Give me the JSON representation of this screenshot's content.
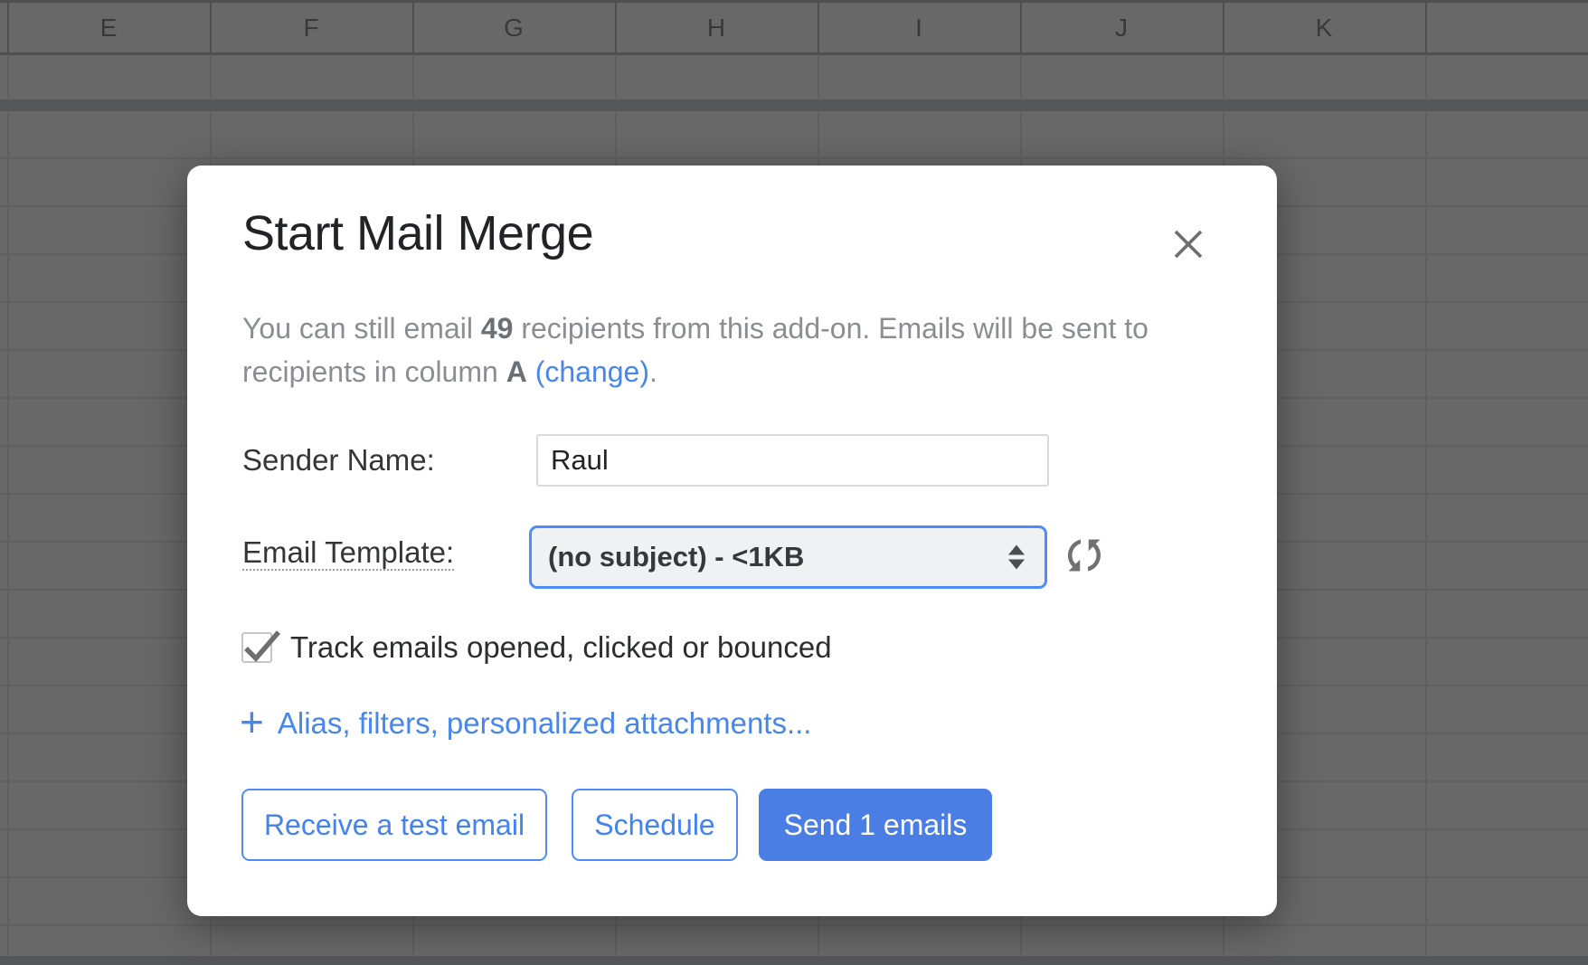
{
  "spreadsheet": {
    "columns": [
      "E",
      "F",
      "G",
      "H",
      "I",
      "J",
      "K"
    ]
  },
  "dialog": {
    "title": "Start Mail Merge",
    "intro": {
      "text_before_count": "You can still email ",
      "count": "49",
      "text_after_count": " recipients from this add-on. Emails will be sent to recipients in column ",
      "column": "A",
      "change_link": "(change)",
      "period": "."
    },
    "sender_name": {
      "label": "Sender Name:",
      "value": "Raul"
    },
    "email_template": {
      "label": "Email Template:",
      "selected_option": "(no subject) - <1KB"
    },
    "tracking": {
      "label": "Track emails opened, clicked or bounced",
      "checked": true
    },
    "alias_link": {
      "plus": "+",
      "label": "Alias, filters, personalized attachments..."
    },
    "buttons": {
      "test": "Receive a test email",
      "schedule": "Schedule",
      "send": "Send 1 emails"
    }
  },
  "icons": {
    "close": "close-icon",
    "refresh": "refresh-icon",
    "select_spinner": "updown-arrows-icon",
    "checkmark": "checkmark-icon"
  },
  "colors": {
    "accent_blue_border": "#4e8cf7",
    "accent_blue_text": "#4382ef",
    "link_blue": "#4786ec",
    "send_button_fill": "#4a7ee4",
    "dim_background": "#686868",
    "modal_background": "#ffffff"
  }
}
